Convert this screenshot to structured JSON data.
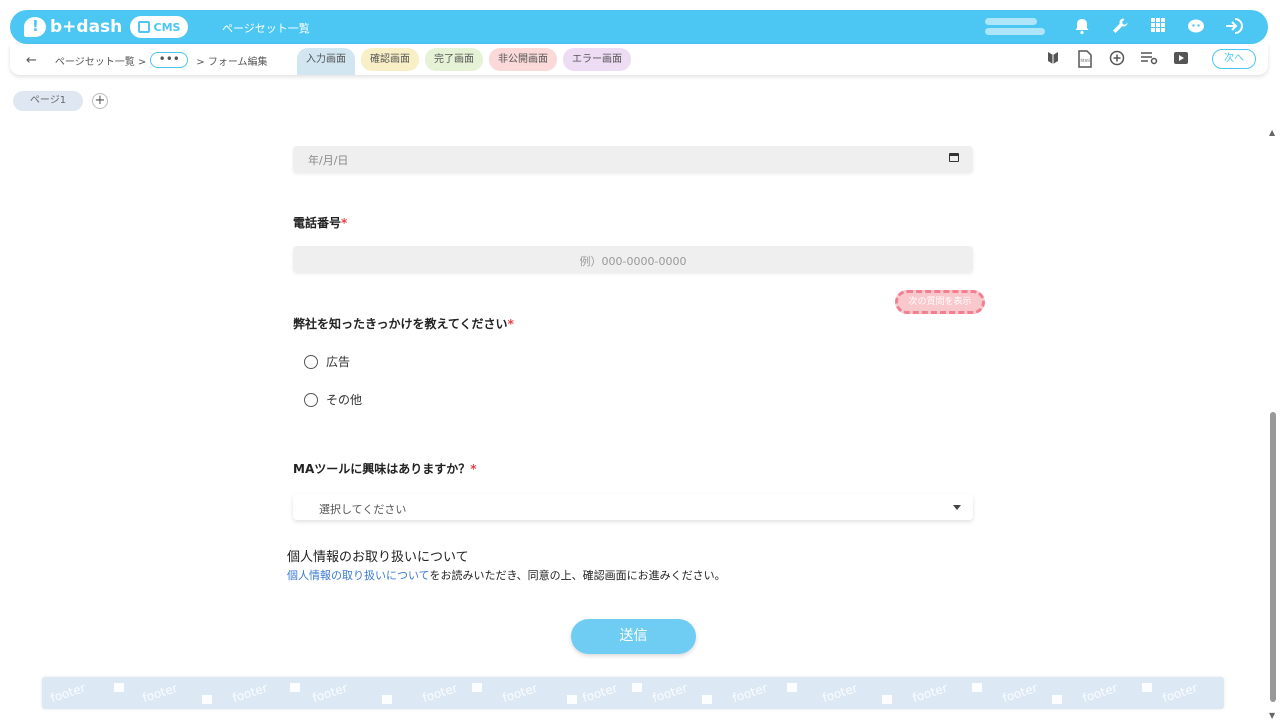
{
  "topbar": {
    "logo_text": "b+dash",
    "cms_label": "CMS",
    "page_title": "ページセット一覧",
    "icons": [
      "bell-icon",
      "wrench-icon",
      "grid-icon",
      "assistant-icon",
      "logout-icon"
    ]
  },
  "subbar": {
    "back_glyph": "←",
    "crumb_pageset": "ページセット一覧 >",
    "more_glyph": "•••",
    "crumb_form": "> フォーム編集",
    "tabs": [
      {
        "label": "入力画面",
        "color": "#d2e6f2"
      },
      {
        "label": "確認画面",
        "color": "#f8efc6"
      },
      {
        "label": "完了画面",
        "color": "#e6f2d6"
      },
      {
        "label": "非公開画面",
        "color": "#fbd9d9"
      },
      {
        "label": "エラー画面",
        "color": "#eedcf5"
      }
    ],
    "icons": [
      "beginner-icon",
      "html-file-icon",
      "add-circle-icon",
      "settings-list-icon",
      "play-icon"
    ],
    "next_label": "次へ"
  },
  "pages": {
    "page1_label": "ページ1",
    "add_glyph": "+"
  },
  "form": {
    "date_placeholder": "年/月/日",
    "tel_label": "電話番号",
    "tel_placeholder": "例）000-0000-0000",
    "next_question_label": "次の質問を表示",
    "source_label": "弊社を知ったきっかけを教えてください",
    "source_options": [
      "広告",
      "その他"
    ],
    "ma_label": "MAツールに興味はありますか？",
    "ma_placeholder": "選択してください",
    "required_mark": "*",
    "privacy_title": "個人情報のお取り扱いについて",
    "privacy_link": "個人情報の取り扱いについて",
    "privacy_text": "をお読みいただき、同意の上、確認画面にお進みください。",
    "submit_label": "送信"
  },
  "footer": {
    "watermark": "footer"
  },
  "colors": {
    "accent": "#4cc6f2",
    "required": "#e8414d",
    "link": "#3a7bd5"
  }
}
